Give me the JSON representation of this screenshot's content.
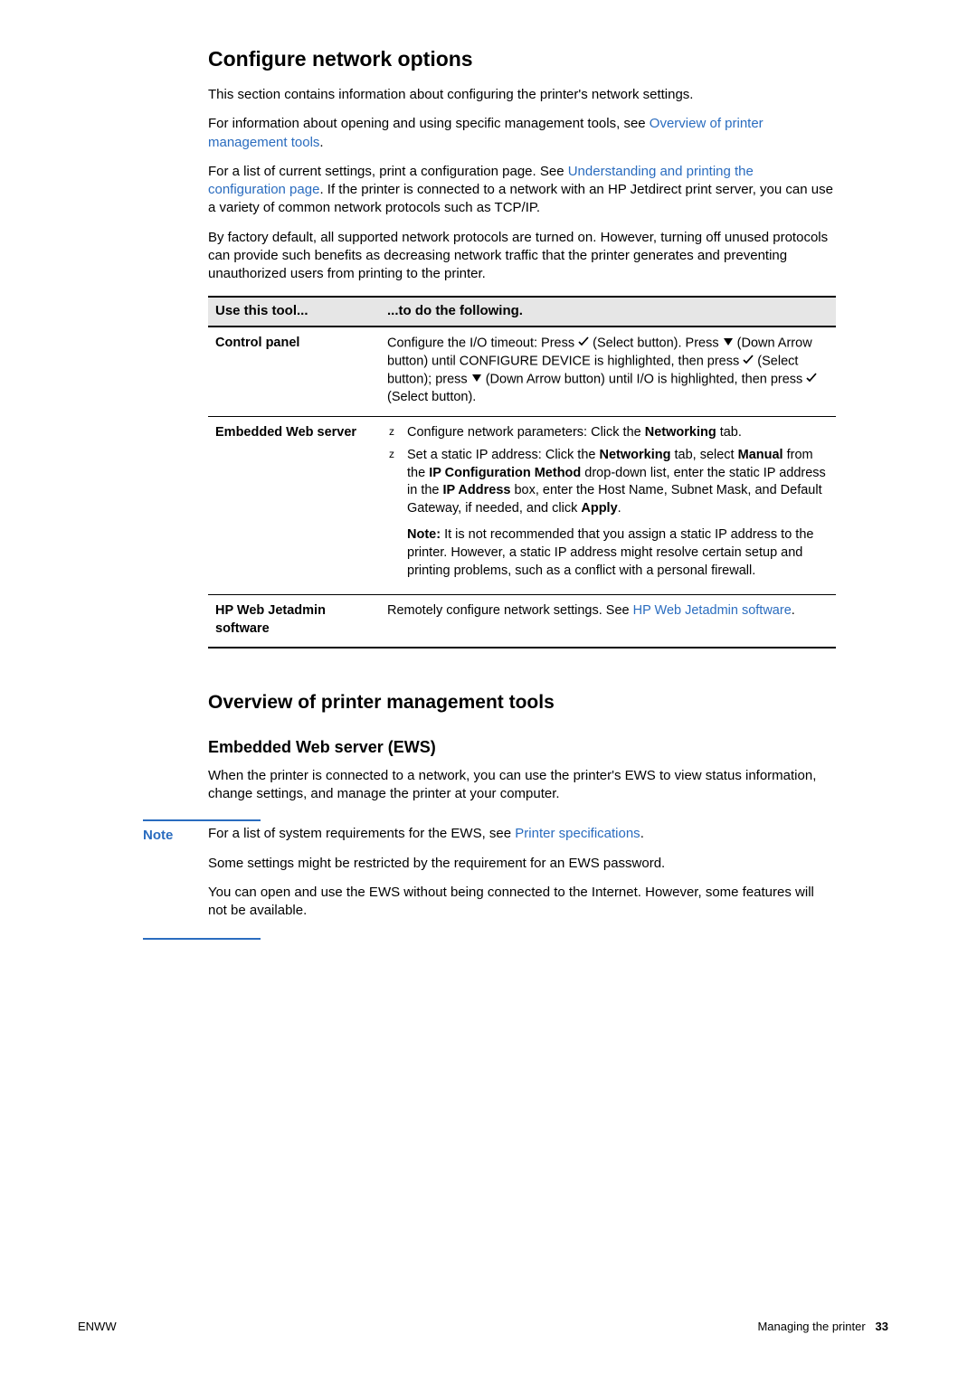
{
  "h1": "Configure network options",
  "intro1": "This section contains information about configuring the printer's network settings.",
  "intro2_pre": "For information about opening and using specific management tools, see ",
  "intro2_link": "Overview of printer management tools",
  "intro2_post": ".",
  "intro3_pre": "For a list of current settings, print a configuration page. See ",
  "intro3_link": "Understanding and printing the configuration page",
  "intro3_post": ". If the printer is connected to a network with an HP Jetdirect print server, you can use a variety of common network protocols such as TCP/IP.",
  "intro4": "By factory default, all supported network protocols are turned on. However, turning off unused protocols can provide such benefits as decreasing network traffic that the printer generates and preventing unauthorized users from printing to the printer.",
  "table_header_left": "Use this tool...",
  "table_header_right": "...to do the following.",
  "row1_left": "Control panel",
  "row1_seg1": "Configure the I/O timeout: Press ",
  "row1_seg2": " (Select button). Press ",
  "row1_seg3": " (Down Arrow button) until CONFIGURE DEVICE is highlighted, then press ",
  "row1_seg4": " (Select button); press ",
  "row1_seg5": " (Down Arrow button) until I/O  is highlighted, then press ",
  "row1_seg6": "  (Select button).",
  "row2_left": "Embedded Web server",
  "row2_b1_pre": "Configure network parameters: Click the ",
  "row2_b1_bold": "Networking",
  "row2_b1_post": " tab.",
  "row2_b2_seg1": "Set a static IP address: Click the ",
  "row2_b2_bold1": "Networking",
  "row2_b2_seg2": " tab, select ",
  "row2_b2_bold2": "Manual",
  "row2_b2_seg3": " from the ",
  "row2_b2_bold3": "IP Configuration Method",
  "row2_b2_seg4": " drop-down list, enter the static IP address in the ",
  "row2_b2_bold4": "IP Address",
  "row2_b2_seg5": " box, enter the Host Name, Subnet Mask, and Default Gateway, if needed, and click ",
  "row2_b2_bold5": "Apply",
  "row2_b2_seg6": ".",
  "row2_note_label": "Note:",
  "row2_note_text": " It is not recommended that you assign a static IP address to the printer. However, a static IP address might resolve certain setup and printing problems, such as a conflict with a personal firewall.",
  "row3_left": "HP Web Jetadmin software",
  "row3_seg1": "Remotely configure network settings. See ",
  "row3_link": "HP Web Jetadmin software",
  "row3_seg2": ".",
  "h2": "Overview of printer management tools",
  "h3": "Embedded Web server (EWS)",
  "ews_para": "When the printer is connected to a network, you can use the printer's EWS to view status information, change settings, and manage the printer at your computer.",
  "note_label": "Note",
  "note_p1_pre": "For a list of system requirements for the EWS, see ",
  "note_p1_link": "Printer specifications",
  "note_p1_post": ".",
  "note_p2": "Some settings might be restricted by the requirement for an EWS password.",
  "note_p3": "You can open and use the EWS without being connected to the Internet. However, some features will not be available.",
  "bullet_z": "z",
  "footer_left": "ENWW",
  "footer_right_text": "Managing the printer",
  "footer_right_num": "33"
}
